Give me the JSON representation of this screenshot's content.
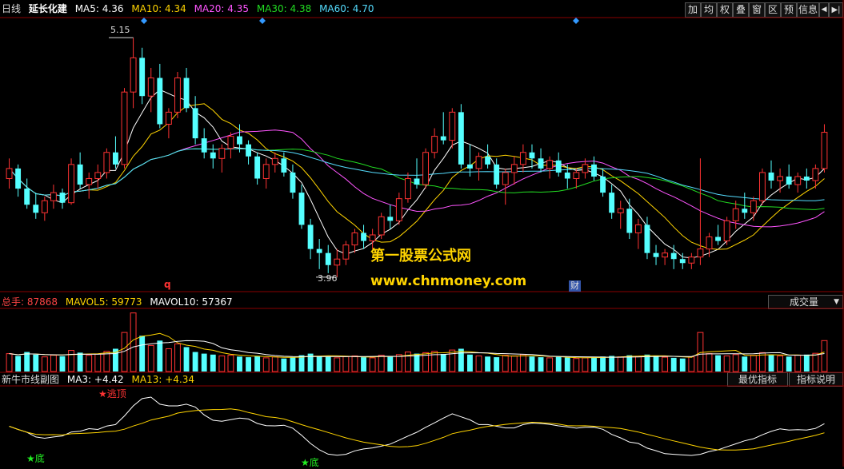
{
  "header": {
    "period": "日线",
    "stock_name": "延长化建",
    "ma": [
      {
        "label": "MA5:",
        "value": "4.36",
        "color": "#ffffff"
      },
      {
        "label": "MA10:",
        "value": "4.34",
        "color": "#ffd400"
      },
      {
        "label": "MA20:",
        "value": "4.35",
        "color": "#ff55ff"
      },
      {
        "label": "MA30:",
        "value": "4.38",
        "color": "#22dd22"
      },
      {
        "label": "MA60:",
        "value": "4.70",
        "color": "#55ddff"
      }
    ],
    "buttons": [
      "加",
      "均",
      "权",
      "叠",
      "窗",
      "区",
      "预",
      "信息",
      "◀",
      "▶|"
    ]
  },
  "price_chart": {
    "high_label": "5.15",
    "low_label": "3.96",
    "marker_q": "q",
    "marker_cai": "财",
    "up_color": "#ff3333",
    "down_color": "#55ffff"
  },
  "volume_panel": {
    "total_label": "总手:",
    "total_value": "87868",
    "mavol5_label": "MAVOL5:",
    "mavol5_value": "59773",
    "mavol10_label": "MAVOL10:",
    "mavol10_value": "57367",
    "selector": "成交量"
  },
  "indicator_panel": {
    "name": "新牛市线副图",
    "ma3_label": "MA3:",
    "ma3_value": "+4.42",
    "ma13_label": "MA13:",
    "ma13_value": "+4.34",
    "btn_best": "最优指标",
    "btn_help": "指标说明",
    "top_signal": "★逃顶",
    "bottom_signal": "★底"
  },
  "watermark": {
    "line1": "第一股票公式网",
    "line2": "www.chnmoney.com"
  },
  "chart_data": {
    "type": "candlestick",
    "ylim": [
      3.9,
      5.25
    ],
    "candles": [
      [
        4.45,
        4.55,
        4.4,
        4.5
      ],
      [
        4.5,
        4.52,
        4.36,
        4.4
      ],
      [
        4.4,
        4.45,
        4.3,
        4.32
      ],
      [
        4.32,
        4.38,
        4.25,
        4.28
      ],
      [
        4.28,
        4.36,
        4.24,
        4.34
      ],
      [
        4.34,
        4.42,
        4.3,
        4.38
      ],
      [
        4.38,
        4.4,
        4.3,
        4.33
      ],
      [
        4.33,
        4.55,
        4.32,
        4.52
      ],
      [
        4.52,
        4.58,
        4.4,
        4.42
      ],
      [
        4.42,
        4.48,
        4.35,
        4.45
      ],
      [
        4.45,
        4.52,
        4.4,
        4.48
      ],
      [
        4.48,
        4.6,
        4.45,
        4.58
      ],
      [
        4.58,
        4.66,
        4.5,
        4.52
      ],
      [
        4.52,
        4.9,
        4.5,
        4.88
      ],
      [
        4.88,
        5.15,
        4.8,
        5.05
      ],
      [
        5.05,
        5.1,
        4.82,
        4.86
      ],
      [
        4.86,
        5.0,
        4.78,
        4.95
      ],
      [
        4.95,
        5.02,
        4.7,
        4.72
      ],
      [
        4.72,
        4.8,
        4.65,
        4.78
      ],
      [
        4.78,
        4.98,
        4.75,
        4.95
      ],
      [
        4.95,
        5.0,
        4.78,
        4.8
      ],
      [
        4.8,
        4.86,
        4.62,
        4.65
      ],
      [
        4.65,
        4.7,
        4.55,
        4.58
      ],
      [
        4.58,
        4.62,
        4.5,
        4.55
      ],
      [
        4.55,
        4.62,
        4.48,
        4.6
      ],
      [
        4.6,
        4.68,
        4.55,
        4.66
      ],
      [
        4.66,
        4.72,
        4.58,
        4.62
      ],
      [
        4.62,
        4.64,
        4.52,
        4.56
      ],
      [
        4.56,
        4.58,
        4.42,
        4.45
      ],
      [
        4.45,
        4.55,
        4.4,
        4.52
      ],
      [
        4.52,
        4.58,
        4.48,
        4.55
      ],
      [
        4.55,
        4.58,
        4.46,
        4.48
      ],
      [
        4.48,
        4.52,
        4.35,
        4.38
      ],
      [
        4.38,
        4.42,
        4.2,
        4.22
      ],
      [
        4.22,
        4.25,
        4.05,
        4.1
      ],
      [
        4.1,
        4.15,
        4.0,
        4.08
      ],
      [
        4.08,
        4.12,
        3.98,
        4.02
      ],
      [
        4.02,
        4.1,
        3.96,
        4.05
      ],
      [
        4.05,
        4.14,
        4.02,
        4.12
      ],
      [
        4.12,
        4.2,
        4.08,
        4.18
      ],
      [
        4.18,
        4.22,
        4.1,
        4.14
      ],
      [
        4.14,
        4.2,
        4.1,
        4.17
      ],
      [
        4.17,
        4.28,
        4.15,
        4.26
      ],
      [
        4.26,
        4.32,
        4.2,
        4.24
      ],
      [
        4.24,
        4.38,
        4.22,
        4.35
      ],
      [
        4.35,
        4.48,
        4.33,
        4.45
      ],
      [
        4.45,
        4.55,
        4.4,
        4.42
      ],
      [
        4.42,
        4.6,
        4.4,
        4.58
      ],
      [
        4.58,
        4.7,
        4.55,
        4.66
      ],
      [
        4.66,
        4.78,
        4.62,
        4.64
      ],
      [
        4.64,
        4.8,
        4.6,
        4.78
      ],
      [
        4.78,
        4.82,
        4.5,
        4.52
      ],
      [
        4.52,
        4.62,
        4.46,
        4.5
      ],
      [
        4.5,
        4.58,
        4.44,
        4.56
      ],
      [
        4.56,
        4.62,
        4.5,
        4.52
      ],
      [
        4.52,
        4.55,
        4.4,
        4.42
      ],
      [
        4.42,
        4.5,
        4.32,
        4.48
      ],
      [
        4.48,
        4.56,
        4.42,
        4.52
      ],
      [
        4.52,
        4.62,
        4.48,
        4.58
      ],
      [
        4.58,
        4.62,
        4.5,
        4.55
      ],
      [
        4.55,
        4.6,
        4.48,
        4.5
      ],
      [
        4.5,
        4.56,
        4.45,
        4.54
      ],
      [
        4.54,
        4.58,
        4.46,
        4.48
      ],
      [
        4.48,
        4.52,
        4.4,
        4.45
      ],
      [
        4.45,
        4.5,
        4.4,
        4.48
      ],
      [
        4.48,
        4.55,
        4.45,
        4.52
      ],
      [
        4.52,
        4.56,
        4.44,
        4.46
      ],
      [
        4.46,
        4.5,
        4.36,
        4.38
      ],
      [
        4.38,
        4.42,
        4.25,
        4.28
      ],
      [
        4.28,
        4.34,
        4.2,
        4.3
      ],
      [
        4.3,
        4.35,
        4.15,
        4.18
      ],
      [
        4.18,
        4.25,
        4.1,
        4.22
      ],
      [
        4.22,
        4.26,
        4.05,
        4.08
      ],
      [
        4.08,
        4.12,
        4.02,
        4.06
      ],
      [
        4.06,
        4.1,
        4.02,
        4.08
      ],
      [
        4.08,
        4.12,
        4.0,
        4.05
      ],
      [
        4.05,
        4.08,
        4.0,
        4.03
      ],
      [
        4.03,
        4.08,
        4.0,
        4.06
      ],
      [
        4.06,
        4.55,
        4.02,
        4.1
      ],
      [
        4.1,
        4.18,
        4.06,
        4.16
      ],
      [
        4.16,
        4.22,
        4.12,
        4.14
      ],
      [
        4.14,
        4.26,
        4.12,
        4.24
      ],
      [
        4.24,
        4.34,
        4.2,
        4.3
      ],
      [
        4.3,
        4.38,
        4.25,
        4.28
      ],
      [
        4.28,
        4.36,
        4.24,
        4.34
      ],
      [
        4.34,
        4.5,
        4.32,
        4.48
      ],
      [
        4.48,
        4.54,
        4.4,
        4.44
      ],
      [
        4.44,
        4.5,
        4.38,
        4.46
      ],
      [
        4.46,
        4.52,
        4.4,
        4.42
      ],
      [
        4.42,
        4.48,
        4.38,
        4.46
      ],
      [
        4.46,
        4.5,
        4.4,
        4.44
      ],
      [
        4.44,
        4.52,
        4.4,
        4.5
      ],
      [
        4.5,
        4.72,
        4.48,
        4.68
      ]
    ],
    "volume": [
      55,
      48,
      60,
      52,
      45,
      50,
      47,
      65,
      58,
      50,
      54,
      62,
      70,
      120,
      180,
      110,
      80,
      95,
      70,
      85,
      75,
      60,
      55,
      52,
      48,
      50,
      46,
      44,
      48,
      42,
      45,
      40,
      44,
      50,
      55,
      48,
      45,
      42,
      46,
      48,
      44,
      42,
      50,
      46,
      52,
      60,
      55,
      58,
      62,
      54,
      66,
      70,
      52,
      48,
      46,
      44,
      50,
      48,
      52,
      46,
      44,
      42,
      45,
      43,
      40,
      42,
      44,
      46,
      48,
      45,
      50,
      47,
      52,
      48,
      44,
      42,
      40,
      45,
      120,
      55,
      50,
      48,
      52,
      46,
      50,
      58,
      52,
      48,
      46,
      50,
      52,
      56,
      95
    ],
    "volume_unit": "lots"
  }
}
